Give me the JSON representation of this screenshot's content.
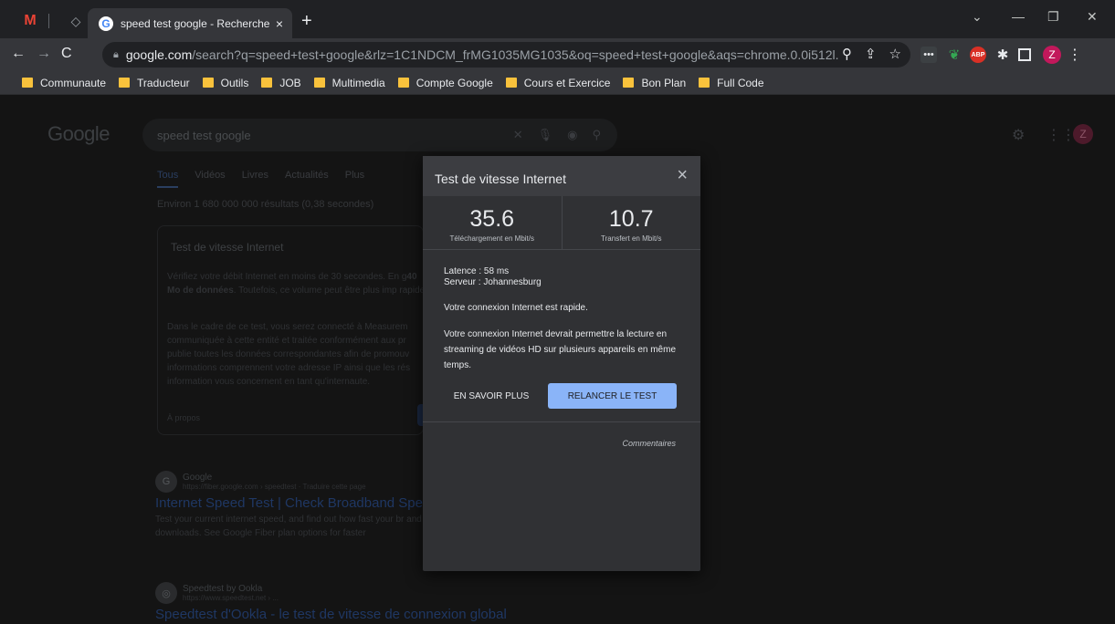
{
  "browser": {
    "tab_title": "speed test google - Recherche G",
    "tab_close": "×",
    "new_tab": "+",
    "url_domain": "google.com",
    "url_path": "/search?q=speed+test+google&rlz=1C1NDCM_frMG1035MG1035&oq=speed+test+google&aqs=chrome.0.0i512l...",
    "profile_initial": "Z",
    "bookmarks": [
      "Communaute",
      "Traducteur",
      "Outils",
      "JOB",
      "Multimedia",
      "Compte Google",
      "Cours et Exercice",
      "Bon Plan",
      "Full Code"
    ]
  },
  "google": {
    "logo": "Google",
    "query": "speed test google",
    "avatar": "Z",
    "tabs": [
      "Tous",
      "Vidéos",
      "Livres",
      "Actualités",
      "Plus"
    ],
    "results_count": "Environ 1 680 000 000 résultats (0,38 secondes)",
    "card_title": "Test de vitesse Internet",
    "card_p1_a": "Vérifiez votre débit Internet en moins de 30 secondes. En g",
    "card_p1_b": "40 Mo de données",
    "card_p1_c": ". Toutefois, ce volume peut être plus imp",
    "card_p1_d": "rapides.",
    "card_p2": "Dans le cadre de ce test, vous serez connecté à Measurem communiquée à cette entité et traitée conformément aux pr publie toutes les données correspondantes afin de promouv informations comprennent votre adresse IP ainsi que les rés information vous concernent en tant qu'internaute.",
    "card_about": "À propos",
    "result1": {
      "icon": "G",
      "site": "Google",
      "url": "https://fiber.google.com › speedtest · Traduire cette page",
      "title": "Internet Speed Test | Check Broadband Spe",
      "snippet": "Test your current internet speed, and find out how fast your br and downloads. See Google Fiber plan options for faster"
    },
    "result2": {
      "icon": "◎",
      "site": "Speedtest by Ookla",
      "url": "https://www.speedtest.net › ...",
      "title": "Speedtest d'Ookla - le test de vitesse de connexion global"
    }
  },
  "dialog": {
    "title": "Test de vitesse Internet",
    "close": "×",
    "download_value": "35.6",
    "download_label": "Téléchargement en Mbit/s",
    "upload_value": "10.7",
    "upload_label": "Transfert en Mbit/s",
    "latency_label": "Latence : ",
    "latency_value": "58 ms",
    "server_label": "Serveur : ",
    "server_value": "Johannesburg",
    "message1": "Votre connexion Internet est rapide.",
    "message2": "Votre connexion Internet devrait permettre la lecture en streaming de vidéos HD sur plusieurs appareils en même temps.",
    "learn_more": "EN SAVOIR PLUS",
    "retest": "RELANCER LE TEST",
    "feedback": "Commentaires"
  }
}
